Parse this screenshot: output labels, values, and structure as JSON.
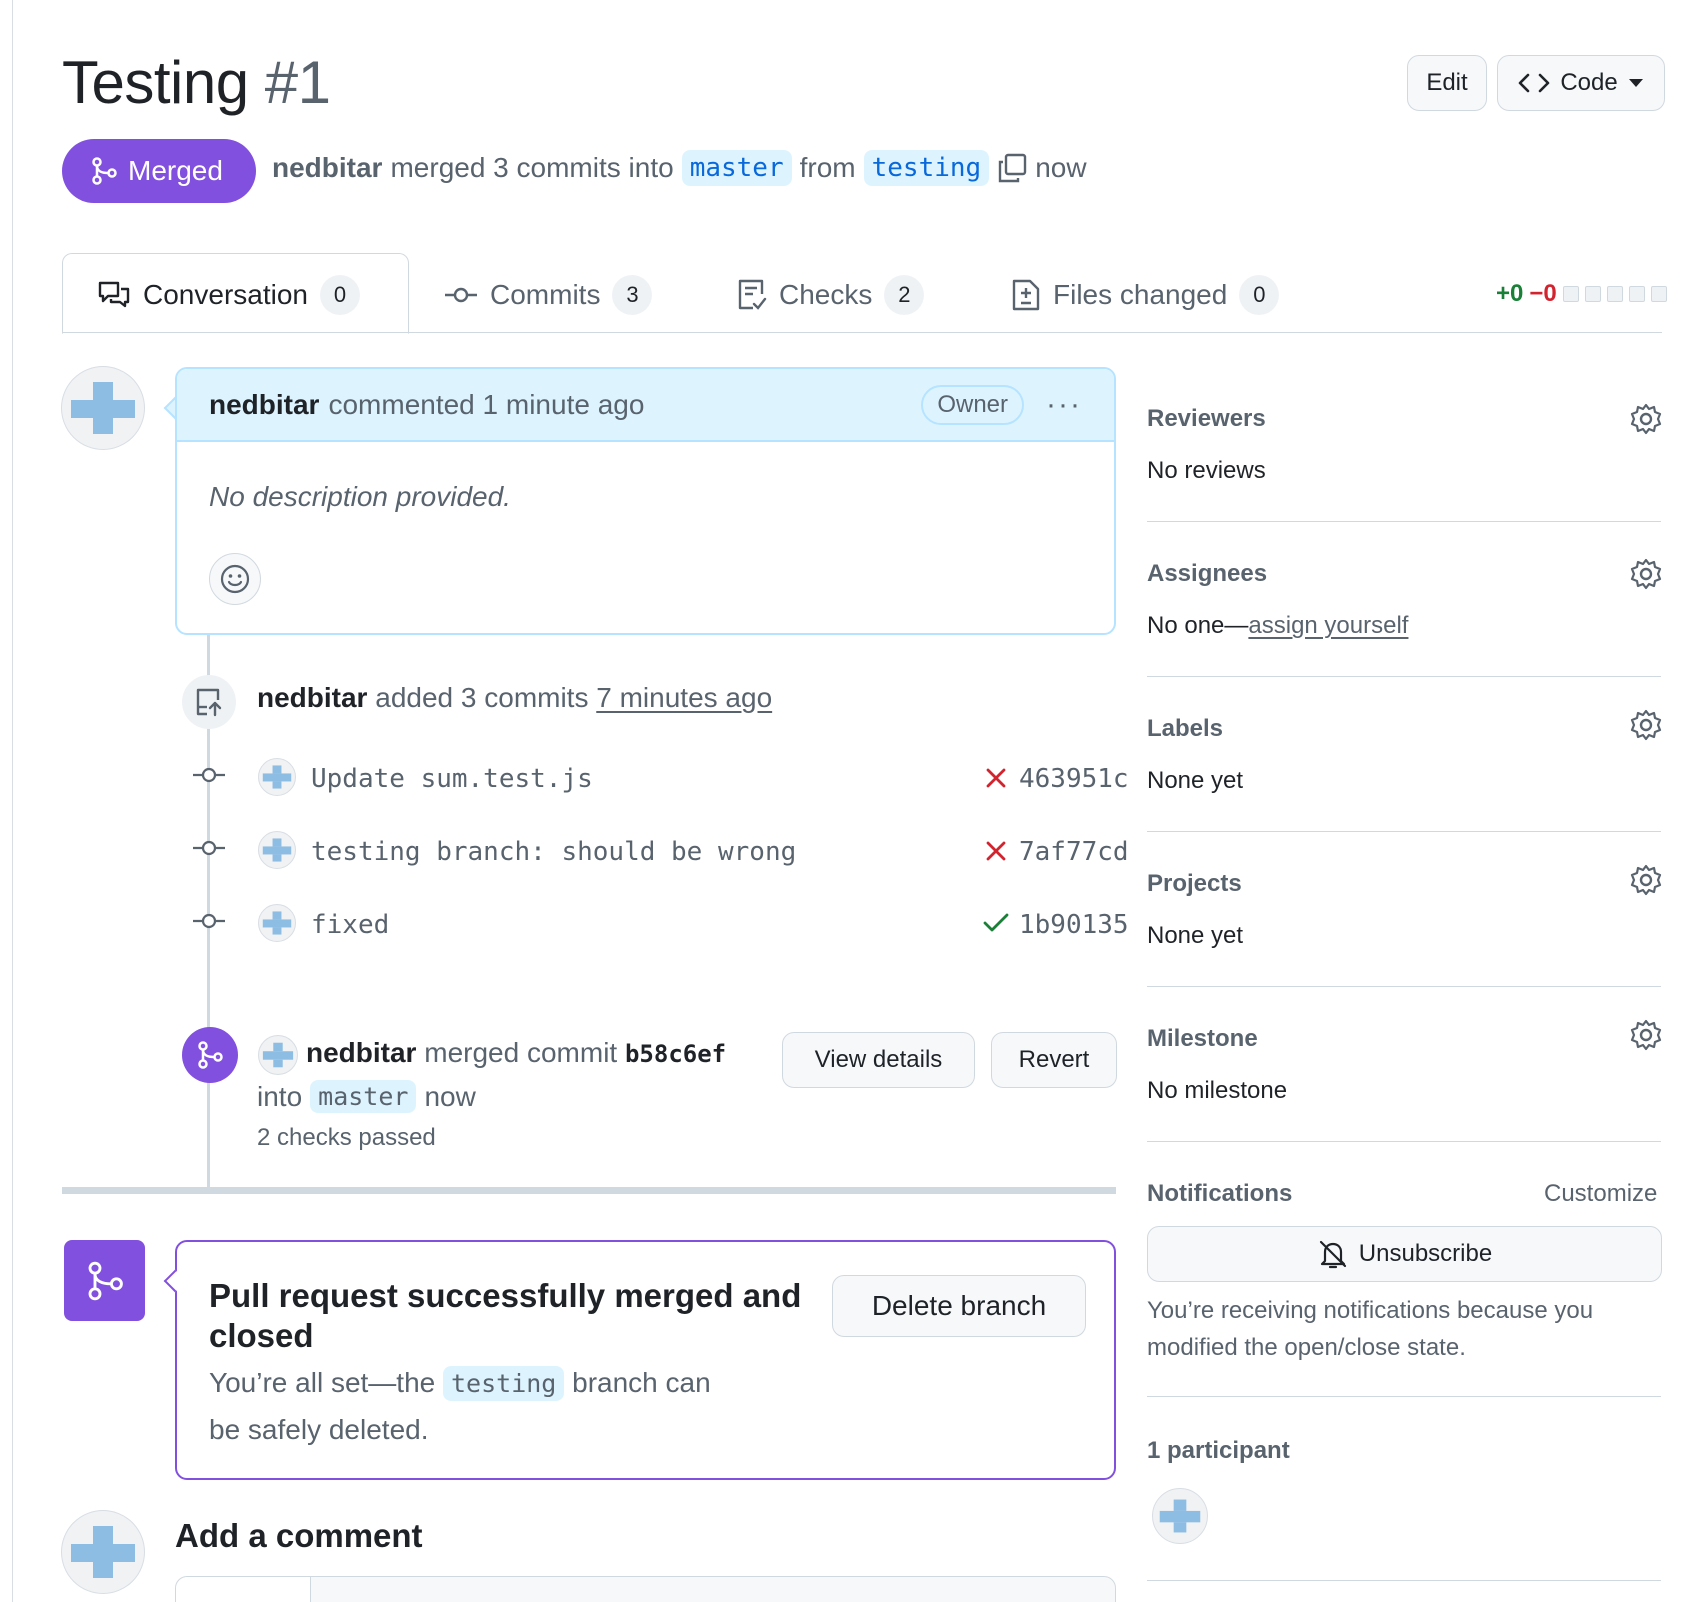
{
  "header": {
    "title": "Testing",
    "number": "#1",
    "edit_label": "Edit",
    "code_label": "Code"
  },
  "status": {
    "badge": "Merged",
    "author": "nedbitar",
    "action": "merged 3 commits into",
    "base_branch": "master",
    "from_word": "from",
    "head_branch": "testing",
    "time": "now"
  },
  "tabs": [
    {
      "label": "Conversation",
      "count": "0"
    },
    {
      "label": "Commits",
      "count": "3"
    },
    {
      "label": "Checks",
      "count": "2"
    },
    {
      "label": "Files changed",
      "count": "0"
    }
  ],
  "diffstat": {
    "additions": "+0",
    "deletions": "−0"
  },
  "comment": {
    "author": "nedbitar",
    "action": "commented 1 minute ago",
    "role": "Owner",
    "more": "···",
    "body": "No description provided."
  },
  "commits_event": {
    "author": "nedbitar",
    "action": "added 3 commits",
    "time": "7 minutes ago",
    "commits": [
      {
        "message": "Update sum.test.js",
        "sha": "463951c",
        "status": "fail"
      },
      {
        "message": "testing branch: should be wrong",
        "sha": "7af77cd",
        "status": "fail"
      },
      {
        "message": "fixed",
        "sha": "1b90135",
        "status": "success"
      }
    ]
  },
  "merge_event": {
    "author": "nedbitar",
    "action": "merged commit",
    "sha": "b58c6ef",
    "into": "into",
    "branch": "master",
    "time": "now",
    "checks": "2 checks passed",
    "view_details": "View details",
    "revert": "Revert"
  },
  "merged_box": {
    "title": "Pull request successfully merged and closed",
    "sub_prefix": "You’re all set—the",
    "branch": "testing",
    "sub_suffix1": "branch can",
    "sub_suffix2": "be safely deleted.",
    "delete_label": "Delete branch"
  },
  "add_comment": {
    "title": "Add a comment"
  },
  "sidebar": {
    "reviewers": {
      "title": "Reviewers",
      "value": "No reviews"
    },
    "assignees": {
      "title": "Assignees",
      "value_prefix": "No one—",
      "link": "assign yourself"
    },
    "labels": {
      "title": "Labels",
      "value": "None yet"
    },
    "projects": {
      "title": "Projects",
      "value": "None yet"
    },
    "milestone": {
      "title": "Milestone",
      "value": "No milestone"
    },
    "notifications": {
      "title": "Notifications",
      "customize": "Customize",
      "unsubscribe": "Unsubscribe",
      "reason": "You’re receiving notifications because you modified the open/close state."
    },
    "participants": {
      "title": "1 participant"
    }
  },
  "colors": {
    "merged": "#8250df",
    "link": "#0969da",
    "success": "#1a7f37",
    "danger": "#d1242f",
    "border": "#d1d9e0"
  }
}
